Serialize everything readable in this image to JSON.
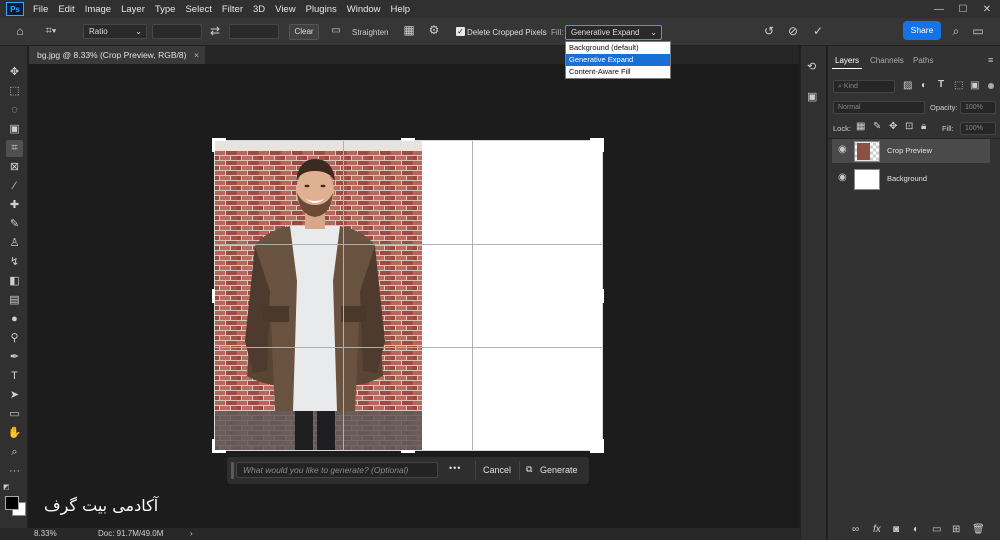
{
  "menu": {
    "logo": "Ps",
    "items": [
      "File",
      "Edit",
      "Image",
      "Layer",
      "Type",
      "Select",
      "Filter",
      "3D",
      "View",
      "Plugins",
      "Window",
      "Help"
    ]
  },
  "options": {
    "ratio_value": "Ratio",
    "clear_label": "Clear",
    "straighten_label": "Straighten",
    "delete_cropped_label": "Delete Cropped Pixels",
    "fill_label": "Fill:",
    "fill_value": "Generative Expand",
    "share_label": "Share"
  },
  "fill_menu": {
    "options": [
      "Background (default)",
      "Generative Expand",
      "Content-Aware Fill"
    ]
  },
  "document": {
    "tab_title": "bg.jpg @ 8.33% (Crop Preview, RGB/8)",
    "close": "×"
  },
  "generate_bar": {
    "placeholder": "What would you like to generate? (Optional)",
    "more": "•••",
    "cancel_label": "Cancel",
    "generate_label": "Generate"
  },
  "status": {
    "zoom": "8.33%",
    "doc": "Doc: 91.7M/49.0M",
    "arrow": "›"
  },
  "layers_panel": {
    "tabs": [
      "Layers",
      "Channels",
      "Paths"
    ],
    "kind_placeholder": "Kind",
    "blend_mode": "Normal",
    "opacity_label": "Opacity:",
    "opacity_value": "100%",
    "lock_label": "Lock:",
    "fill_label": "Fill:",
    "fill_value": "100%",
    "layers": [
      {
        "name": "Crop Preview"
      },
      {
        "name": "Background"
      }
    ]
  },
  "watermark": "آکادمی بیت گرف",
  "colors": {
    "accent": "#1473e6",
    "selection": "#1a6fd6"
  }
}
